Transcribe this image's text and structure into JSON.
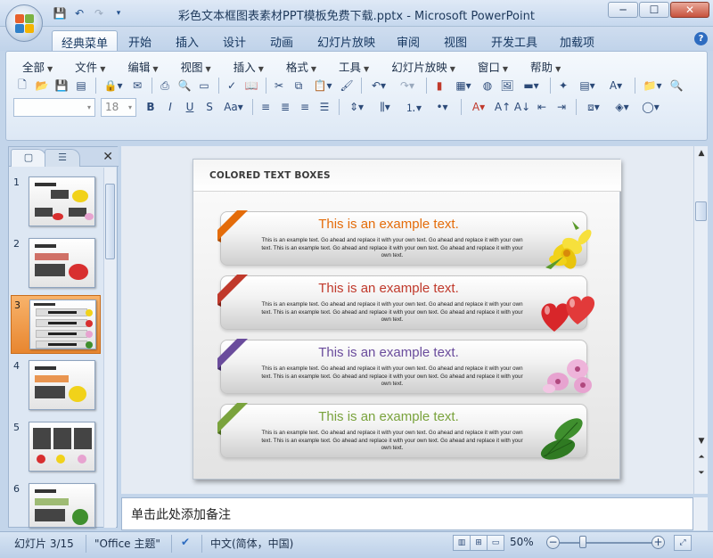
{
  "window": {
    "title": "彩色文本框图表素材PPT模板免费下载.pptx - Microsoft PowerPoint",
    "minimize": "─",
    "maximize": "☐",
    "close": "✕"
  },
  "quick_access": {
    "save_icon": "save-icon",
    "undo_icon": "undo-icon",
    "redo_icon": "redo-icon",
    "customize_icon": "dropdown-icon"
  },
  "tabs": [
    "经典菜单",
    "开始",
    "插入",
    "设计",
    "动画",
    "幻灯片放映",
    "审阅",
    "视图",
    "开发工具",
    "加载项"
  ],
  "active_tab": "经典菜单",
  "menus": [
    "全部",
    "文件",
    "编辑",
    "视图",
    "插入",
    "格式",
    "工具",
    "幻灯片放映",
    "窗口",
    "帮助"
  ],
  "font_size": "18",
  "font_name": "",
  "slides_panel": {
    "tab_slides": "▢",
    "tab_outline": "☰",
    "close": "✕",
    "slide_numbers": [
      "1",
      "2",
      "3",
      "4",
      "5",
      "6"
    ],
    "selected": 3
  },
  "slide": {
    "title": "COLORED TEXT BOXES",
    "boxes": [
      {
        "heading": "This is an example text.",
        "color": "#e46c0a",
        "body": "This is an example text. Go ahead and replace it with your own text. Go ahead and replace it with your own text. This is an example text. Go ahead and replace it with your own text. Go ahead and replace it with your own text.",
        "decoration": "yellow-flower-icon"
      },
      {
        "heading": "This is an example text.",
        "color": "#c0392b",
        "body": "This is an example text. Go ahead and replace it with your own text. Go ahead and replace it with your own text. This is an example text. Go ahead and replace it with your own text. Go ahead and replace it with your own text.",
        "decoration": "red-hearts-icon"
      },
      {
        "heading": "This is an example text.",
        "color": "#6a4c9c",
        "body": "This is an example text. Go ahead and replace it with your own text. Go ahead and replace it with your own text. This is an example text. Go ahead and replace it with your own text. Go ahead and replace it with your own text.",
        "decoration": "orchid-icon"
      },
      {
        "heading": "This is an example text.",
        "color": "#7aa33d",
        "body": "This is an example text. Go ahead and replace it with your own text. Go ahead and replace it with your own text. This is an example text. Go ahead and replace it with your own text. Go ahead and replace it with your own text.",
        "decoration": "green-leaves-icon"
      }
    ]
  },
  "notes": {
    "placeholder": "单击此处添加备注"
  },
  "status": {
    "slide_info": "幻灯片 3/15",
    "theme": "\"Office 主题\"",
    "language": "中文(简体，中国)",
    "zoom": "50%",
    "zoom_out": "−",
    "zoom_in": "+"
  }
}
